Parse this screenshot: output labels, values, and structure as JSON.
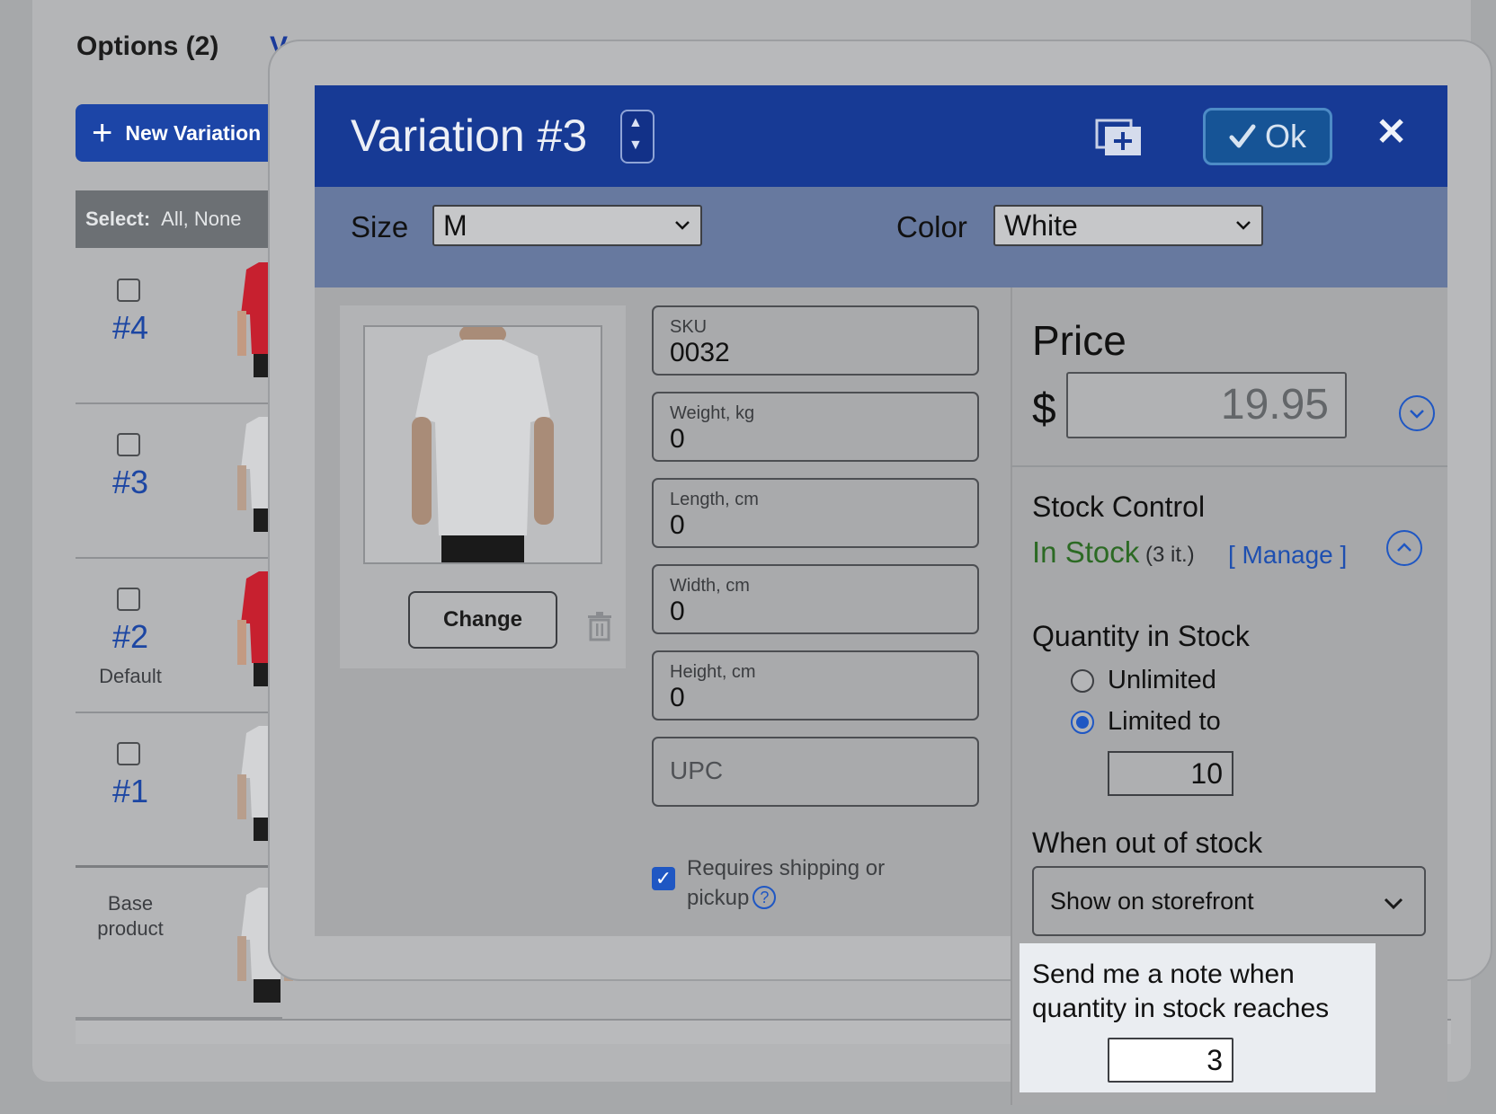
{
  "background": {
    "options_title": "Options (2)",
    "variations_tab": "V",
    "new_variation_label": "New Variation",
    "select_label": "Select:",
    "select_options": "All, None",
    "rows": [
      {
        "num": "#4",
        "sub": "",
        "shirt_color": "#c7202f"
      },
      {
        "num": "#3",
        "sub": "",
        "shirt_color": "#dcdcdc"
      },
      {
        "num": "#2",
        "sub": "Default",
        "shirt_color": "#c7202f"
      },
      {
        "num": "#1",
        "sub": "",
        "shirt_color": "#dcdcdc"
      }
    ],
    "base_product_label": "Base product"
  },
  "modal": {
    "title": "Variation #3",
    "ok_label": "Ok",
    "close_glyph": "✕",
    "attributes": {
      "size_label": "Size",
      "size_value": "M",
      "color_label": "Color",
      "color_value": "White"
    },
    "image": {
      "change_label": "Change"
    },
    "fields": {
      "sku": {
        "label": "SKU",
        "value": "0032"
      },
      "weight": {
        "label": "Weight, kg",
        "value": "0"
      },
      "length": {
        "label": "Length, cm",
        "value": "0"
      },
      "width": {
        "label": "Width, cm",
        "value": "0"
      },
      "height": {
        "label": "Height, cm",
        "value": "0"
      },
      "upc": {
        "placeholder": "UPC"
      }
    },
    "requires_shipping_label": "Requires shipping or pickup",
    "requires_shipping_checked": true,
    "help_glyph": "?",
    "price": {
      "title": "Price",
      "currency": "$",
      "value": "19.95"
    },
    "stock": {
      "title": "Stock Control",
      "status": "In Stock",
      "count": "(3 it.)",
      "manage_label": "[ Manage ]",
      "quantity_title": "Quantity in Stock",
      "unlimited_label": "Unlimited",
      "limited_label": "Limited to",
      "limited_selected": true,
      "quantity_value": "10",
      "oos_title": "When out of stock",
      "oos_value": "Show on storefront",
      "note_text": "Send me a note when quantity in stock reaches",
      "note_value": "3"
    }
  },
  "colors": {
    "header_blue": "#173a95",
    "link_blue": "#1e4fb0",
    "in_stock_green": "#2c6a24"
  }
}
